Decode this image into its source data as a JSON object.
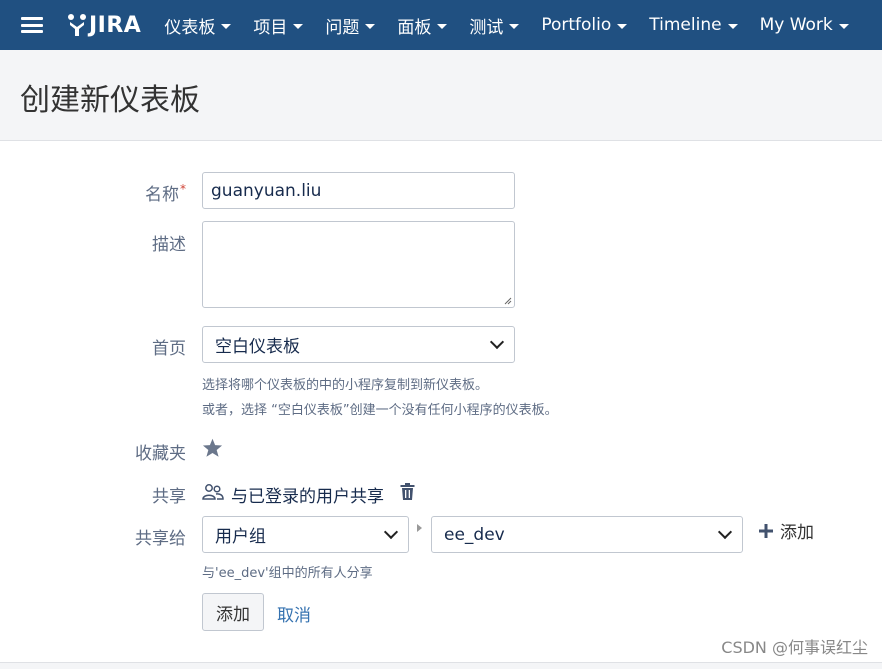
{
  "nav": {
    "logo_text": "JIRA",
    "items": [
      {
        "label": "仪表板"
      },
      {
        "label": "项目"
      },
      {
        "label": "问题"
      },
      {
        "label": "面板"
      },
      {
        "label": "测试"
      },
      {
        "label": "Portfolio"
      },
      {
        "label": "Timeline"
      },
      {
        "label": "My Work"
      }
    ]
  },
  "page": {
    "title": "创建新仪表板"
  },
  "form": {
    "name_label": "名称",
    "name_required_mark": "*",
    "name_value": "guanyuan.liu",
    "description_label": "描述",
    "description_value": "",
    "homepage_label": "首页",
    "homepage_selected": "空白仪表板",
    "homepage_help_1": "选择将哪个仪表板的中的小程序复制到新仪表板。",
    "homepage_help_2": "或者，选择 “空白仪表板”创建一个没有任何小程序的仪表板。",
    "favorite_label": "收藏夹",
    "share_label": "共享",
    "share_value": "与已登录的用户共享",
    "share_to_label": "共享给",
    "share_type_selected": "用户组",
    "share_group_selected": "ee_dev",
    "add_share_label": "添加",
    "share_help": "与'ee_dev'组中的所有人分享",
    "submit_label": "添加",
    "cancel_label": "取消"
  },
  "watermark": "CSDN @何事误红尘",
  "colors": {
    "topbar": "#205081",
    "link": "#3572b0",
    "required": "#d04437"
  }
}
